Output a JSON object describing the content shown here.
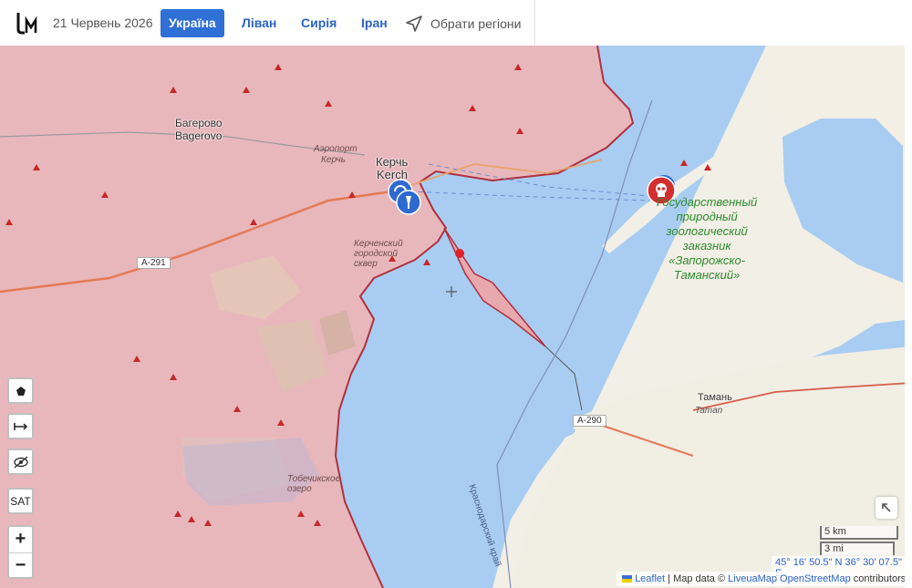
{
  "header": {
    "date": "21 Червень 2026",
    "tabs": [
      {
        "label": "Україна",
        "active": true
      },
      {
        "label": "Ліван",
        "active": false
      },
      {
        "label": "Сирія",
        "active": false
      },
      {
        "label": "Іран",
        "active": false
      }
    ],
    "regions_label": "Обрати регіони"
  },
  "map": {
    "labels": {
      "bagerovo_ru": "Багерово",
      "bagerovo_en": "Bagerovo",
      "airport": "Аэропорт",
      "airport_sub": "Керчь",
      "kerch_ru": "Керчь",
      "kerch_en": "Kerch",
      "kerch_park": "Керченский городской сквер",
      "reserve": [
        "Государственный",
        "природный",
        "зоологический",
        "заказник",
        "«Запорожско-",
        "Таманский»"
      ],
      "taman_ru": "Тамань",
      "taman_en": "Taman",
      "tobechik": "Тобечикское озеро",
      "krasnodar_krai": "Краснодарский край",
      "road_a291": "A-291",
      "road_a290": "A-290"
    },
    "controls": {
      "polygon_icon": "pentagon-icon",
      "measure_icon": "measure-arrows-icon",
      "hide_icon": "eye-slash-icon",
      "sat_label": "SAT",
      "zoom_in": "+",
      "zoom_out": "−",
      "collapse_icon": "arrow-up-left-icon"
    },
    "scale": {
      "km": "5 km",
      "mi": "3 mi"
    },
    "coordinates": "45° 16' 50.5\" N 36° 30' 07.5\" E",
    "attribution": {
      "leaflet": "Leaflet",
      "separator": " | Map data © ",
      "liveuamap": "LiveuaMap",
      "osm": "OpenStreetMap",
      "suffix": " contributors"
    }
  },
  "colors": {
    "occupied": "#e8b7bc",
    "sea": "#a9cdf2",
    "land": "#f2efe6",
    "front_line": "#b0303e",
    "accent": "#2f6fd6"
  }
}
